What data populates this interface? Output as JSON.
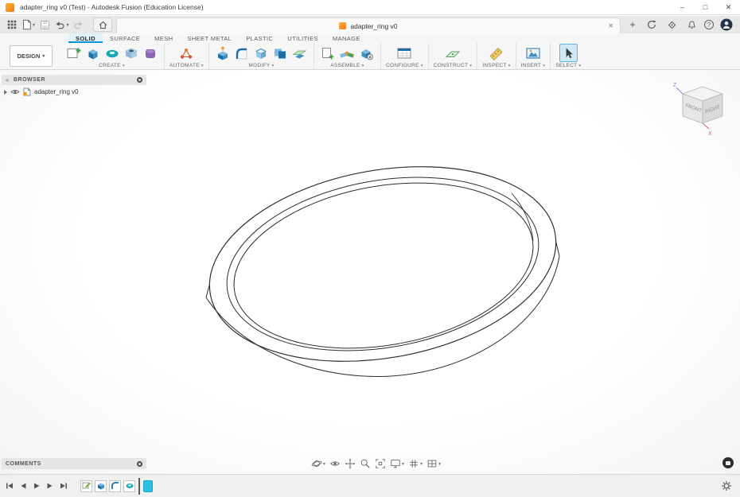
{
  "window": {
    "title": "adapter_ring v0 (Test) - Autodesk Fusion (Education License)",
    "minimize_glyph": "–",
    "maximize_glyph": "□",
    "close_glyph": "✕"
  },
  "quick_access": {
    "icons": [
      "app-grid",
      "file-menu",
      "save",
      "undo",
      "redo",
      "home"
    ]
  },
  "tab_strip": {
    "tab": {
      "label": "adapter_ring v0",
      "close_glyph": "✕"
    },
    "new_tab_glyph": "+",
    "help_glyph": "?",
    "right_icons": [
      "job-status",
      "extensions",
      "notifications",
      "help",
      "account-avatar"
    ]
  },
  "ribbon": {
    "workspace_label": "DESIGN",
    "tabs": [
      {
        "label": "SOLID",
        "active": true
      },
      {
        "label": "SURFACE"
      },
      {
        "label": "MESH"
      },
      {
        "label": "SHEET METAL"
      },
      {
        "label": "PLASTIC"
      },
      {
        "label": "UTILITIES"
      },
      {
        "label": "MANAGE"
      }
    ],
    "groups": [
      {
        "label": "CREATE",
        "icons": [
          "create-sketch",
          "extrude",
          "revolve",
          "hole",
          "create-form"
        ]
      },
      {
        "label": "AUTOMATE",
        "icons": [
          "automated-modeling"
        ]
      },
      {
        "label": "MODIFY",
        "icons": [
          "press-pull",
          "fillet",
          "shell",
          "combine",
          "split-body"
        ]
      },
      {
        "label": "ASSEMBLE",
        "icons": [
          "new-component",
          "joint",
          "rigid-group"
        ]
      },
      {
        "label": "CONFIGURE",
        "icons": [
          "configuration-table"
        ]
      },
      {
        "label": "CONSTRUCT",
        "icons": [
          "construction-plane"
        ]
      },
      {
        "label": "INSPECT",
        "icons": [
          "measure"
        ]
      },
      {
        "label": "INSERT",
        "icons": [
          "insert-canvas"
        ]
      },
      {
        "label": "SELECT",
        "icons": [
          "select-cursor"
        ]
      }
    ]
  },
  "browser_panel": {
    "collapse_glyph": "«",
    "header": "BROWSER",
    "items": [
      {
        "label": "adapter_ring v0"
      }
    ]
  },
  "viewcube": {
    "front": "FRONT",
    "right": "RIGHT",
    "axis_z": "Z",
    "axis_x": "X"
  },
  "comments_panel": {
    "header": "COMMENTS"
  },
  "nav_bar": {
    "items": [
      "orbit",
      "look-at",
      "pan",
      "zoom",
      "fit",
      "display-settings",
      "grid-and-snaps",
      "viewports"
    ]
  },
  "timeline": {
    "playback": [
      "go-to-start",
      "step-back",
      "play",
      "step-forward",
      "go-to-end"
    ],
    "features": [
      "sketch",
      "feature",
      "feature",
      "feature"
    ],
    "marker": "position-marker",
    "settings_icon": "gear"
  },
  "colors": {
    "accent_blue": "#0696d7",
    "logo_orange": "#f7941e",
    "axis_x_red": "#e05252",
    "axis_z_blue": "#7b8bd8",
    "timeline_marker_teal": "#2bbfe0"
  }
}
